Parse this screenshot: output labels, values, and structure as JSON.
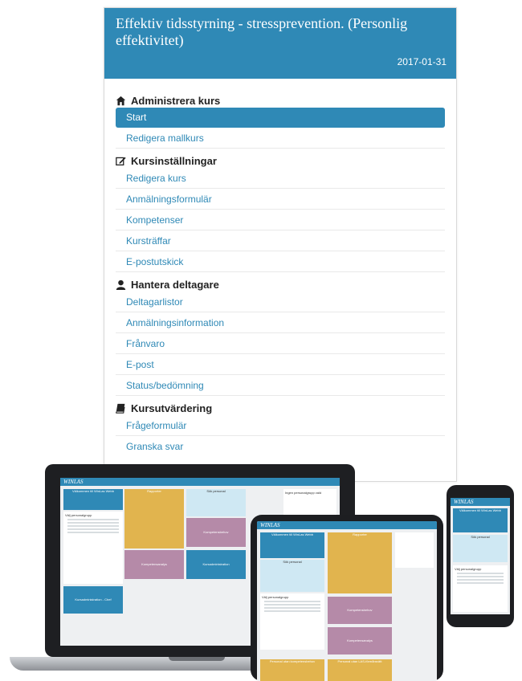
{
  "header": {
    "title": "Effektiv tidsstyrning - stressprevention. (Personlig effektivitet)",
    "date": "2017-01-31"
  },
  "menu": {
    "sections": [
      {
        "title": "Administrera kurs",
        "icon": "home-icon",
        "items": [
          "Start",
          "Redigera mallkurs"
        ]
      },
      {
        "title": "Kursinställningar",
        "icon": "edit-icon",
        "items": [
          "Redigera kurs",
          "Anmälningsformulär",
          "Kompetenser",
          "Kursträffar",
          "E-postutskick"
        ]
      },
      {
        "title": "Hantera deltagare",
        "icon": "user-icon",
        "items": [
          "Deltagarlistor",
          "Anmälningsinformation",
          "Frånvaro",
          "E-post",
          "Status/bedömning"
        ]
      },
      {
        "title": "Kursutvärdering",
        "icon": "book-icon",
        "items": [
          "Frågeformulär",
          "Granska svar"
        ]
      }
    ],
    "active_item": "Start"
  },
  "devices": {
    "logo": "WINLAS",
    "laptop": {
      "welcome": "Välkommen till WinLas Webb",
      "reports": "Rapporter",
      "search": "Sök personal",
      "competence_profiles": "Kompetensbehov",
      "competence_analysis": "Kompetensanalys",
      "course_admin": "Kursadministration",
      "course_admin_chef": "Kursadministration - Chef",
      "personnel_group": "Välj personalgrupp",
      "no_group": "Ingen personalgrupp vald"
    },
    "tablet": {
      "welcome": "Välkommen till WinLas Webb",
      "reports": "Rapporter",
      "search": "Sök personal",
      "competence_profiles": "Kompetensbehov",
      "competence_analysis": "Kompetensanalys",
      "personnel_group": "Välj personalgrupp",
      "staff_missing": "Personal utan kompetensbehov",
      "staff_missing2": "Personal utan LAS-förmånsrätt"
    },
    "phone": {
      "welcome": "Välkommen till WinLas Webb",
      "search": "Sök personal",
      "personnel_group": "Välj personalgrupp"
    }
  },
  "colors": {
    "primary": "#2f89b6",
    "gold": "#e1b44e",
    "mauve": "#b58aa8"
  }
}
